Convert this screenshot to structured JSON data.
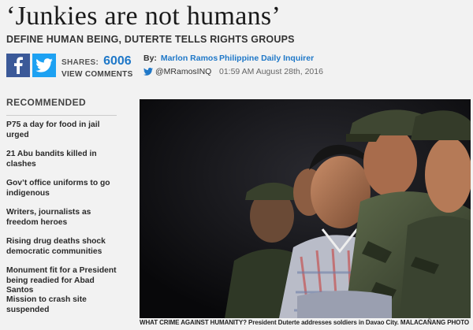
{
  "article": {
    "headline": "‘Junkies are not humans’",
    "subhead": "DEFINE HUMAN BEING, DUTERTE TELLS RIGHTS GROUPS"
  },
  "share": {
    "facebook_icon": "facebook-icon",
    "twitter_icon": "twitter-icon",
    "shares_label": "SHARES:",
    "shares_count": "6006",
    "view_comments": "VIEW COMMENTS"
  },
  "byline": {
    "by_label": "By:",
    "author": "Marlon Ramos",
    "twitter_handle": "@MRamosINQ",
    "publication": "Philippine Daily Inquirer",
    "timestamp": "01:59 AM August 28th, 2016"
  },
  "recommended": {
    "title": "RECOMMENDED",
    "items": [
      "P75 a day for food in jail urged",
      "21 Abu bandits killed in clashes",
      "Gov’t office uniforms to go indigenous",
      "Writers, journalists as freedom heroes",
      "Rising drug deaths shock democratic communities",
      "Monument fit for a President being readied for Abad Santos",
      "Mission to crash site suspended"
    ]
  },
  "photo": {
    "caption": "WHAT CRIME AGAINST HUMANITY? President Duterte addresses soldiers in Davao City. MALACAÑANG PHOTO"
  },
  "colors": {
    "link_blue": "#1f78c8",
    "facebook": "#3b5998",
    "twitter": "#1da1f2"
  }
}
